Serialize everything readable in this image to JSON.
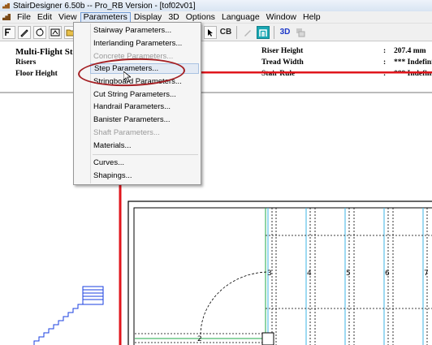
{
  "window": {
    "title": "StairDesigner 6.50b -- Pro_RB Version - [tof02v01]"
  },
  "menubar": {
    "items": [
      "File",
      "Edit",
      "View",
      "Parameters",
      "Display",
      "3D",
      "Options",
      "Language",
      "Window",
      "Help"
    ],
    "active": "Parameters"
  },
  "toolbar": {
    "cb_label": "CB",
    "threed_label": "3D",
    "icons": [
      "new-icon",
      "pencil-icon",
      "rotate-icon",
      "wizard-icon",
      "open-folder-icon",
      "select-icon",
      "pen-gray-icon",
      "stair-teal-icon",
      "threed-icon",
      "windows-icon"
    ]
  },
  "info": {
    "project": "Multi-Flight St",
    "risers_label": "Risers",
    "floor_height_label": "Floor Height",
    "riser_height_label": "Riser Height",
    "tread_width_label": "Tread Width",
    "stair_rule_label": "Stair Rule",
    "colon": ":",
    "riser_height_value": "207.4 mm",
    "tread_width_value": "*** Indefini",
    "stair_rule_value": "*** Indefini"
  },
  "dropdown": {
    "items": [
      {
        "label": "Stairway Parameters...",
        "enabled": true
      },
      {
        "label": "Interlanding Parameters...",
        "enabled": true
      },
      {
        "label": "Concrete Parameters...",
        "enabled": false
      },
      {
        "label": "Step Parameters...",
        "enabled": true,
        "highlighted": true
      },
      {
        "label": "Stringboard Parameters...",
        "enabled": true
      },
      {
        "label": "Cut String Parameters...",
        "enabled": true
      },
      {
        "label": "Handrail Parameters...",
        "enabled": true
      },
      {
        "label": "Banister Parameters...",
        "enabled": true
      },
      {
        "label": "Shaft Parameters...",
        "enabled": false
      },
      {
        "label": "Materials...",
        "enabled": true
      },
      {
        "label": "Curves...",
        "enabled": true
      },
      {
        "label": "Shapings...",
        "enabled": true
      }
    ]
  },
  "drawing": {
    "step_numbers": [
      "2",
      "3",
      "4",
      "5",
      "6",
      "7"
    ],
    "colors": {
      "frame": "#e0161c",
      "treads": "#3cb4e6",
      "stringer": "#1fa84a",
      "elevation": "#1a3fe0"
    }
  }
}
